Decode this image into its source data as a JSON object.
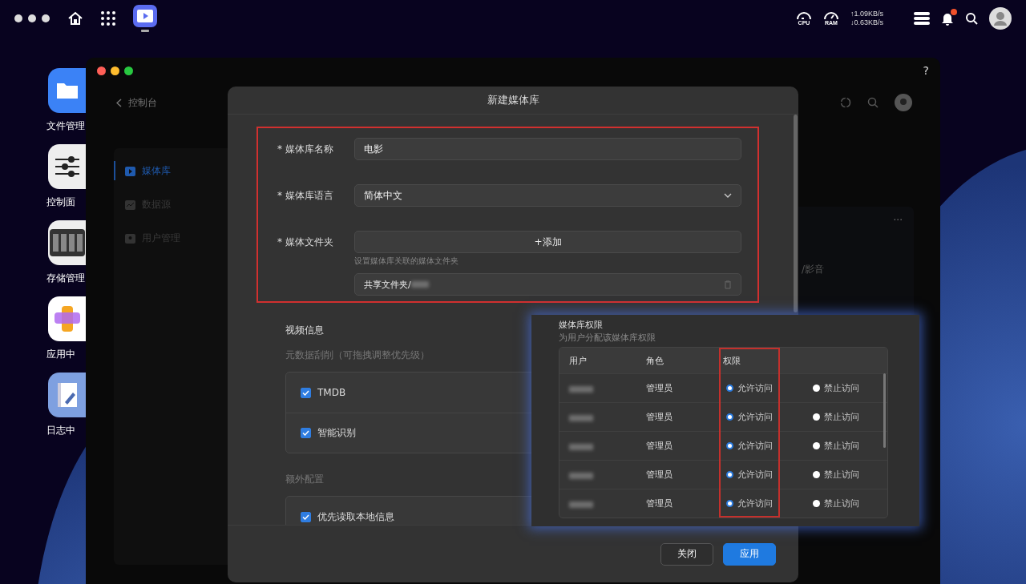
{
  "topbar": {
    "cpu_label": "CPU",
    "ram_label": "RAM",
    "upload": "↑1.09KB/s",
    "download": "↓0.63KB/s",
    "notification_badge": true
  },
  "desktop_icons": [
    {
      "label": "文件管理",
      "kind": "files"
    },
    {
      "label": "控制面",
      "kind": "control"
    },
    {
      "label": "存储管理",
      "kind": "storage"
    },
    {
      "label": "应用中",
      "kind": "apps"
    },
    {
      "label": "日志中",
      "kind": "log"
    }
  ],
  "window": {
    "back_label": "控制台",
    "help": "?",
    "sidebar": [
      {
        "label": "媒体库",
        "kind": "media",
        "selected": true
      },
      {
        "label": "数据源",
        "kind": "source",
        "selected": false
      },
      {
        "label": "用户管理",
        "kind": "users",
        "selected": false
      }
    ],
    "card": {
      "menu": "···",
      "path": "/影音"
    }
  },
  "dialog": {
    "title": "新建媒体库",
    "fields": [
      {
        "kind": "text",
        "required_mark": "*",
        "label": "媒体库名称",
        "value": "电影"
      },
      {
        "kind": "select",
        "required_mark": "*",
        "label": "媒体库语言",
        "value": "简体中文"
      },
      {
        "kind": "folder",
        "required_mark": "*",
        "label": "媒体文件夹",
        "button": "+添加",
        "hint": "设置媒体库关联的媒体文件夹",
        "path": "共享文件夹/"
      }
    ],
    "video_section": {
      "title": "视频信息",
      "subtitle": "元数据刮削（可拖拽调整优先级）",
      "options": [
        {
          "label": "TMDB",
          "checked": true
        },
        {
          "label": "智能识别",
          "checked": true
        }
      ]
    },
    "extra_section": {
      "title": "额外配置",
      "options": [
        {
          "label": "优先读取本地信息",
          "checked": true
        }
      ]
    },
    "buttons": [
      {
        "label": "关闭",
        "kind": "secondary"
      },
      {
        "label": "应用",
        "kind": "primary"
      }
    ]
  },
  "permissions": {
    "title": "媒体库权限",
    "subtitle": "为用户分配该媒体库权限",
    "columns": [
      "用户",
      "角色",
      "权限"
    ],
    "rows": [
      {
        "role": "管理员",
        "options": [
          {
            "label": "允许访问",
            "selected": true
          },
          {
            "label": "禁止访问",
            "selected": false
          }
        ]
      },
      {
        "role": "管理员",
        "options": [
          {
            "label": "允许访问",
            "selected": true
          },
          {
            "label": "禁止访问",
            "selected": false
          }
        ]
      },
      {
        "role": "管理员",
        "options": [
          {
            "label": "允许访问",
            "selected": true
          },
          {
            "label": "禁止访问",
            "selected": false
          }
        ]
      },
      {
        "role": "管理员",
        "options": [
          {
            "label": "允许访问",
            "selected": true
          },
          {
            "label": "禁止访问",
            "selected": false
          }
        ]
      },
      {
        "role": "管理员",
        "options": [
          {
            "label": "允许访问",
            "selected": true
          },
          {
            "label": "禁止访问",
            "selected": false
          }
        ]
      }
    ]
  }
}
